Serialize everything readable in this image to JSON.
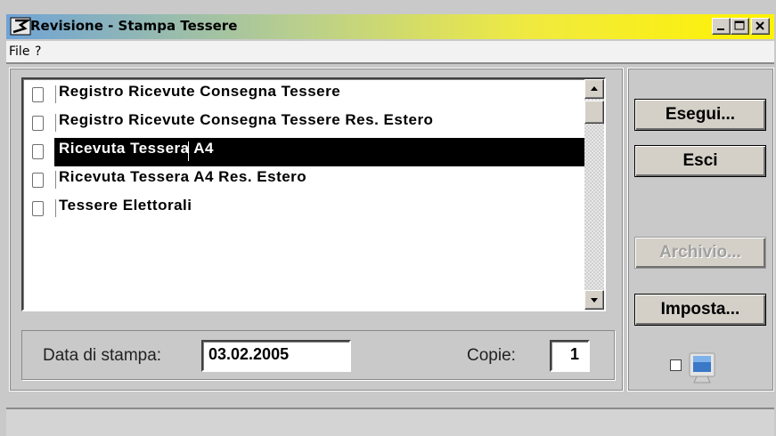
{
  "window": {
    "title": "Revisione - Stampa Tessere"
  },
  "menu": {
    "items": [
      "File",
      "?"
    ]
  },
  "report_list": {
    "items": [
      {
        "label": "Registro Ricevute Consegna Tessere",
        "checked": false,
        "selected": false
      },
      {
        "label": "Registro Ricevute Consegna Tessere Res. Estero",
        "checked": false,
        "selected": false
      },
      {
        "label": "Ricevuta Tessera A4",
        "checked": false,
        "selected": true
      },
      {
        "label": "Ricevuta Tessera A4 Res. Estero",
        "checked": false,
        "selected": false
      },
      {
        "label": "Tessere Elettorali",
        "checked": false,
        "selected": false
      }
    ]
  },
  "print_options": {
    "date_label": "Data di stampa:",
    "date_value": "03.02.2005",
    "copies_label": "Copie:",
    "copies_value": "1"
  },
  "actions": {
    "execute_label": "Esegui...",
    "exit_label": "Esci",
    "archive_label": "Archivio...",
    "setup_label": "Imposta..."
  },
  "colors": {
    "title_gradient_start": "#6fa3d6",
    "title_gradient_end": "#fff200",
    "selection_bg": "#000000",
    "window_bg": "#c9c9c9"
  },
  "icons": [
    "app-logo-icon",
    "minimize-icon",
    "maximize-icon",
    "close-icon",
    "scroll-up-icon",
    "scroll-down-icon",
    "monitor-icon"
  ]
}
